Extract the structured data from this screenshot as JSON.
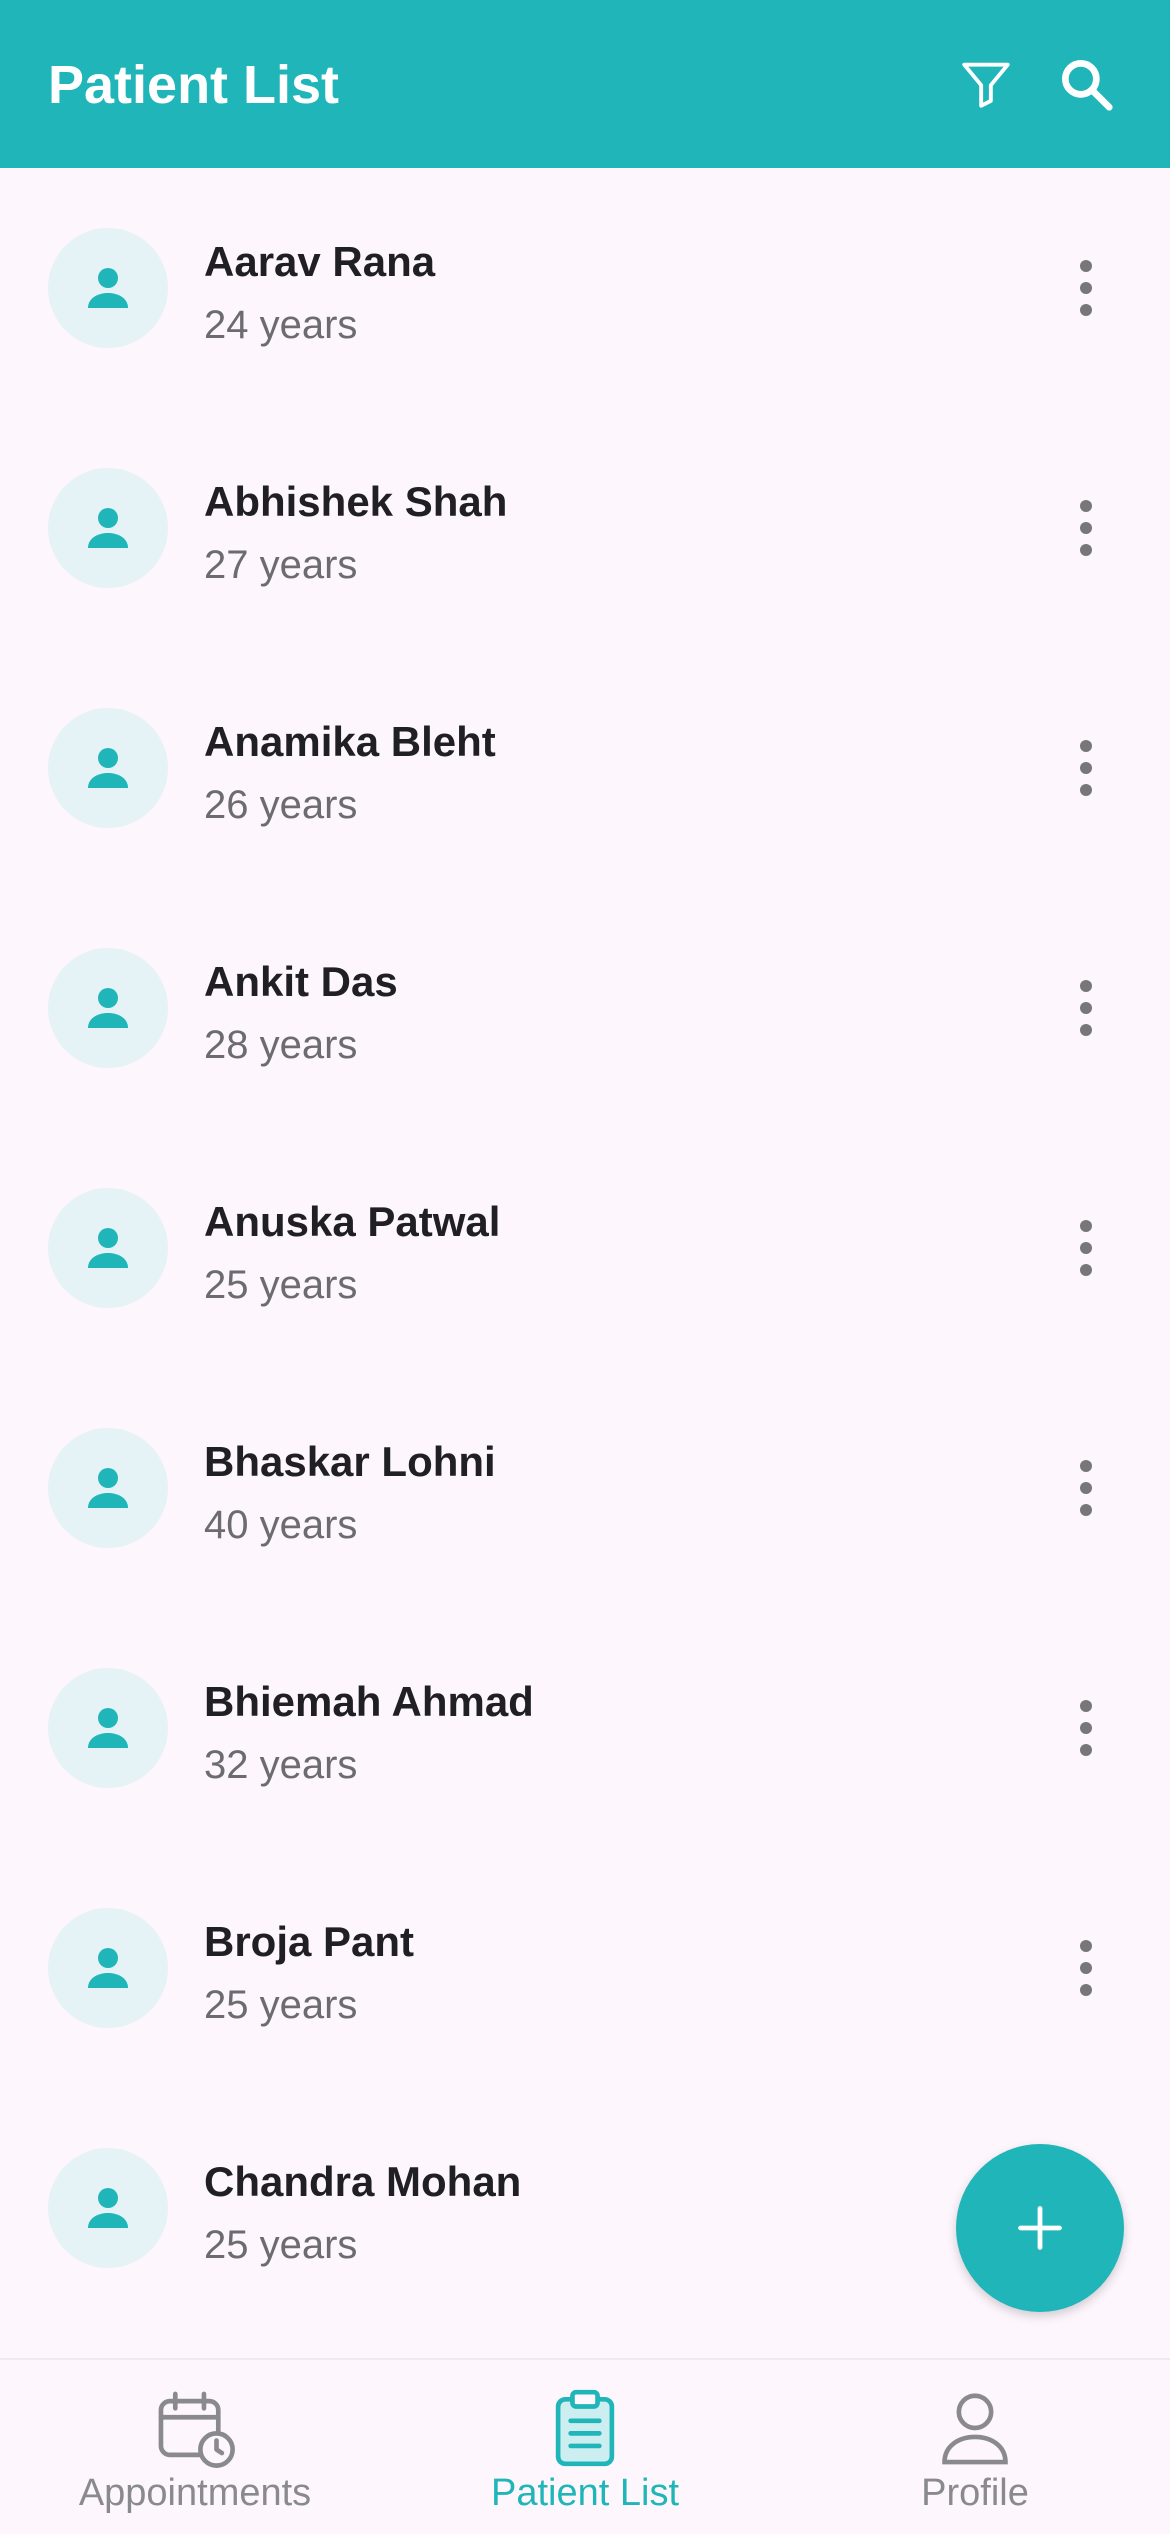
{
  "appbar": {
    "title": "Patient List",
    "filter_icon": "filter-icon",
    "search_icon": "search-icon"
  },
  "colors": {
    "primary": "#20b5b8",
    "background": "#fdf7fd",
    "avatar_bg": "#e5f2f6"
  },
  "patients": [
    {
      "name": "Aarav Rana",
      "age": "24 years"
    },
    {
      "name": "Abhishek Shah",
      "age": "27 years"
    },
    {
      "name": "Anamika Bleht",
      "age": "26 years"
    },
    {
      "name": "Ankit Das",
      "age": "28 years"
    },
    {
      "name": "Anuska Patwal",
      "age": "25 years"
    },
    {
      "name": "Bhaskar Lohni",
      "age": "40 years"
    },
    {
      "name": "Bhiemah Ahmad",
      "age": "32 years"
    },
    {
      "name": "Broja Pant",
      "age": "25 years"
    },
    {
      "name": "Chandra Mohan",
      "age": "25 years"
    }
  ],
  "fab": {
    "icon": "plus-icon"
  },
  "bottom_nav": {
    "items": [
      {
        "label": "Appointments",
        "icon": "calendar-clock-icon",
        "active": false
      },
      {
        "label": "Patient List",
        "icon": "clipboard-icon",
        "active": true
      },
      {
        "label": "Profile",
        "icon": "person-icon",
        "active": false
      }
    ]
  }
}
